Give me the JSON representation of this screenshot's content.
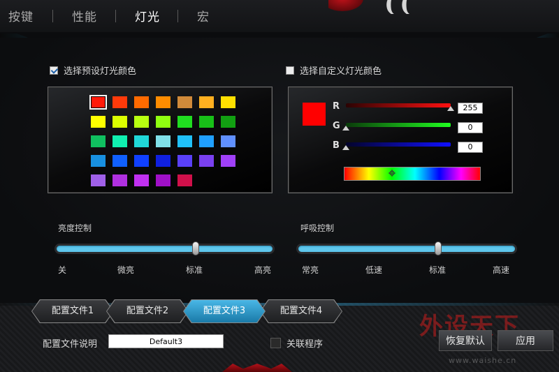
{
  "top_tabs": [
    {
      "label": "按键",
      "active": false
    },
    {
      "label": "性能",
      "active": false
    },
    {
      "label": "灯光",
      "active": true
    },
    {
      "label": "宏",
      "active": false
    }
  ],
  "logo_text": "(( ))BLOOD",
  "preset": {
    "checkbox_label": "选择预设灯光颜色",
    "checked": true,
    "swatch_rows": [
      [
        "#ff1a0a",
        "#ff3a0a",
        "#ff6a00",
        "#ff8c00",
        "#d08a3a",
        "#ffb020",
        "#ffe000"
      ],
      [
        "#ffff00",
        "#dcff00",
        "#b8ff10",
        "#90ff10",
        "#20dd20",
        "#18c018",
        "#12a012"
      ],
      [
        "#10c060",
        "#10f0b0",
        "#20d8d8",
        "#80e0e8",
        "#20c0f8",
        "#20a0ff",
        "#6090ff"
      ],
      [
        "#1890e0",
        "#1060ff",
        "#1040ff",
        "#1020e0",
        "#5a40f8",
        "#7a40f0",
        "#a040f8"
      ],
      [
        "#a060e8",
        "#b030e0",
        "#c030f0",
        "#a010c8",
        "#d0104a"
      ]
    ],
    "selected_swatch": "#ff1a0a"
  },
  "custom": {
    "checkbox_label": "选择自定义灯光颜色",
    "checked": false,
    "preview_color": "#ff0000",
    "channels": [
      {
        "label": "R",
        "value": "255",
        "fraction": 1.0,
        "color_from": "#2a0303",
        "color_to": "#ff1010"
      },
      {
        "label": "G",
        "value": "0",
        "fraction": 0.0,
        "color_from": "#0a3a0a",
        "color_to": "#20ff20"
      },
      {
        "label": "B",
        "value": "0",
        "fraction": 0.0,
        "color_from": "#03032a",
        "color_to": "#1010ff"
      }
    ],
    "spectrum_position": 0.35
  },
  "brightness": {
    "title": "亮度控制",
    "ticks": [
      "关",
      "微亮",
      "标准",
      "高亮"
    ],
    "value_fraction": 0.645
  },
  "breathing": {
    "title": "呼吸控制",
    "ticks": [
      "常亮",
      "低速",
      "标准",
      "高速"
    ],
    "value_fraction": 0.645
  },
  "profiles": [
    {
      "label": "配置文件1",
      "active": false
    },
    {
      "label": "配置文件2",
      "active": false
    },
    {
      "label": "配置文件3",
      "active": true
    },
    {
      "label": "配置文件4",
      "active": false
    }
  ],
  "profile_desc": {
    "label": "配置文件说明",
    "value": "Default3"
  },
  "associate": {
    "label": "关联程序",
    "checked": false
  },
  "buttons": {
    "restore": "恢复默认",
    "apply": "应用"
  },
  "watermark": {
    "main": "外设天下",
    "sub": "www.waishe.cn"
  },
  "colors": {
    "accent": "#5fc7ec",
    "brand_red": "#c0121a"
  }
}
